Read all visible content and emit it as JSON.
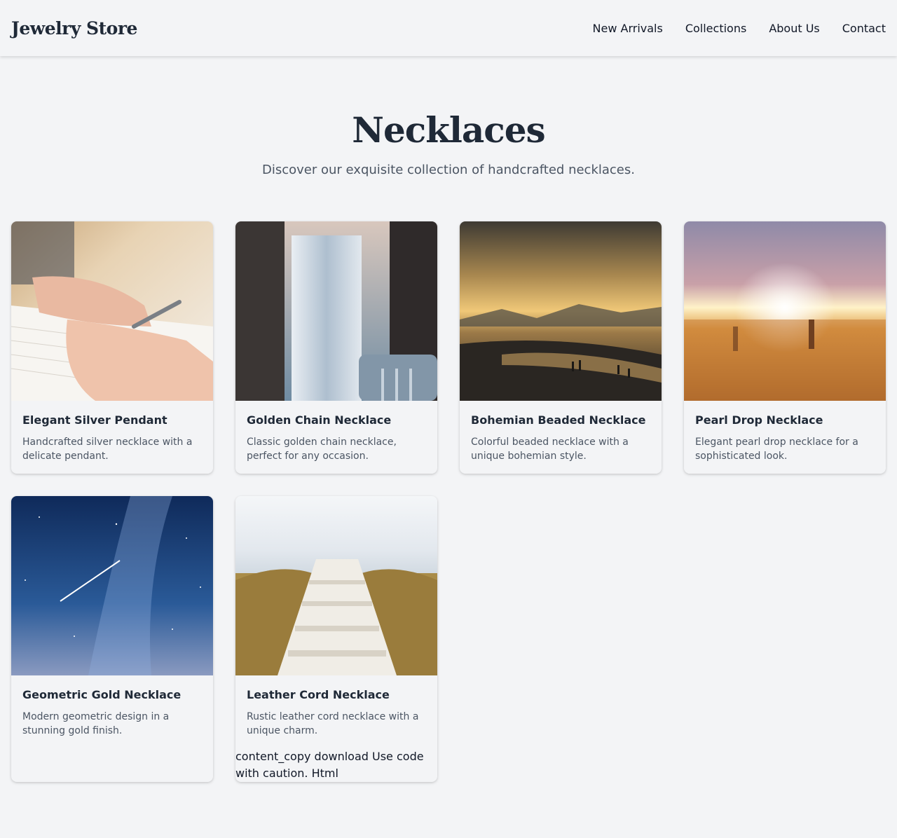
{
  "header": {
    "logo": "Jewelry Store",
    "nav": [
      "New Arrivals",
      "Collections",
      "About Us",
      "Contact"
    ]
  },
  "hero": {
    "title": "Necklaces",
    "subtitle": "Discover our exquisite collection of handcrafted necklaces."
  },
  "products": [
    {
      "title": "Elegant Silver Pendant",
      "desc": "Handcrafted silver necklace with a delicate pendant.",
      "image": "hand-writing-with-pen"
    },
    {
      "title": "Golden Chain Necklace",
      "desc": "Classic golden chain necklace, perfect for any occasion.",
      "image": "window-curtain-chair"
    },
    {
      "title": "Bohemian Beaded Necklace",
      "desc": "Colorful beaded necklace with a unique bohemian style.",
      "image": "beach-sunset"
    },
    {
      "title": "Pearl Drop Necklace",
      "desc": "Elegant pearl drop necklace for a sophisticated look.",
      "image": "field-sunrise"
    },
    {
      "title": "Geometric Gold Necklace",
      "desc": "Modern geometric design in a stunning gold finish.",
      "image": "night-sky-galaxy"
    },
    {
      "title": "Leather Cord Necklace",
      "desc": "Rustic leather cord necklace with a unique charm.",
      "image": "beach-stairs"
    }
  ],
  "code_note": "content_copy download Use code with caution. Html",
  "colors": {
    "background": "#f3f4f6",
    "text": "#1f2937",
    "muted": "#4b5563"
  }
}
